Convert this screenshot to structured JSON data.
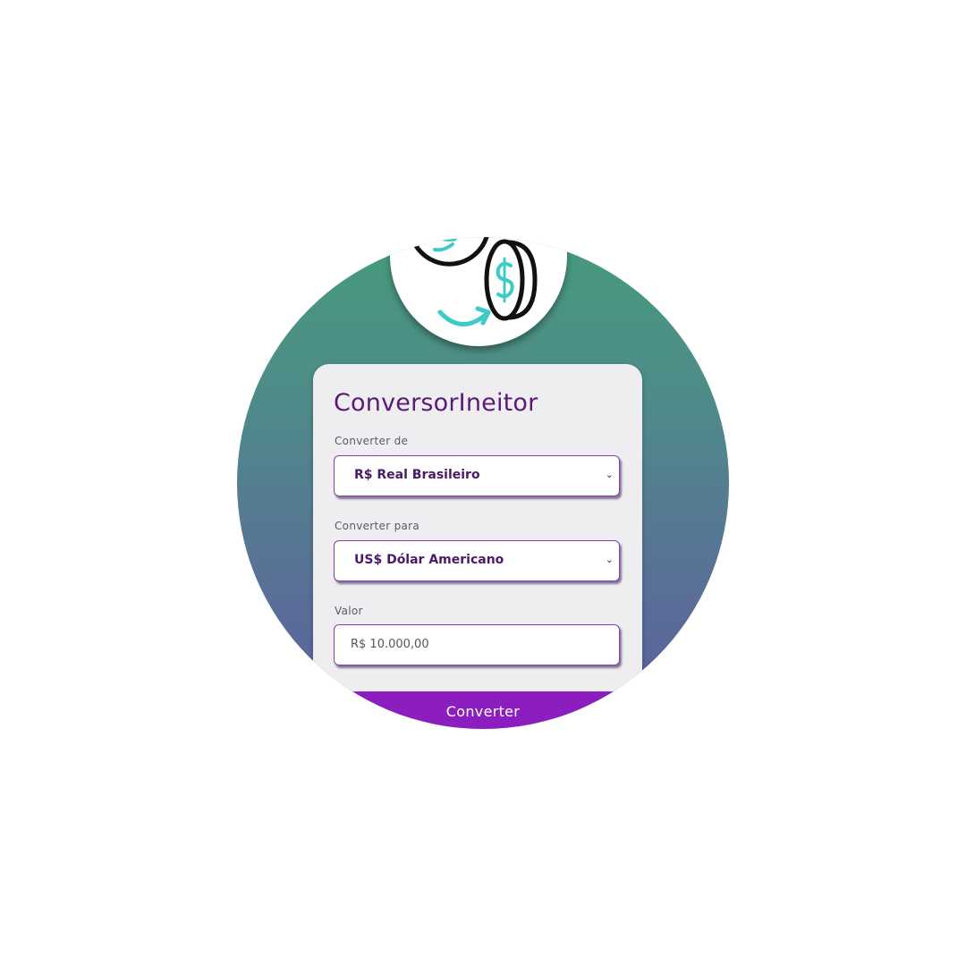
{
  "app": {
    "title": "ConversorIneitor",
    "logo_icon": "currency-exchange-icon"
  },
  "form": {
    "from_label": "Converter de",
    "from_value": "R$ Real Brasileiro",
    "to_label": "Converter para",
    "to_value": "US$ Dólar Americano",
    "amount_label": "Valor",
    "amount_value": "R$ 10.000,00",
    "submit_label": "Converter"
  },
  "colors": {
    "brand_purple": "#8c1ec0",
    "title_purple": "#5a1a78",
    "gradient_top": "#479a7d",
    "gradient_bottom": "#5b5e9e",
    "icon_teal": "#3ccbc8"
  }
}
